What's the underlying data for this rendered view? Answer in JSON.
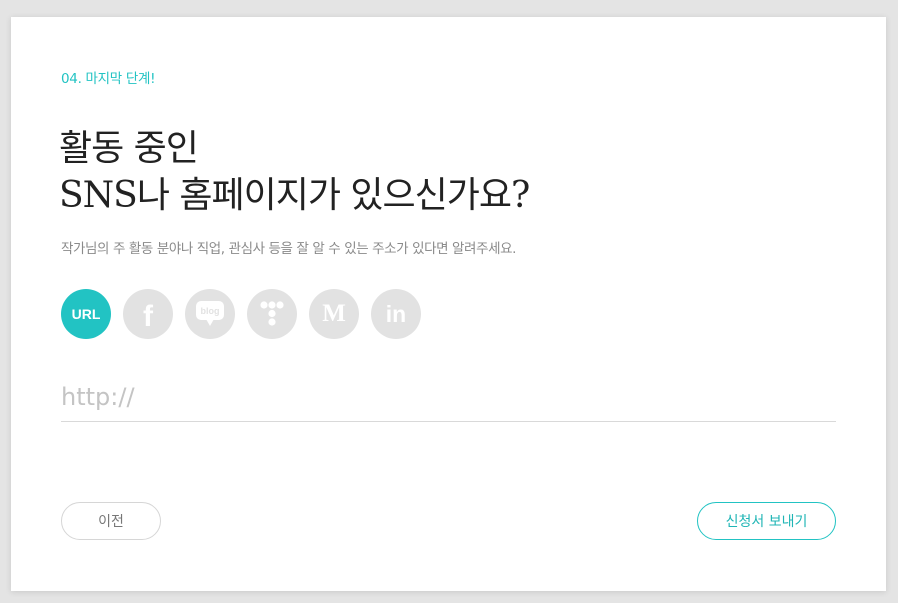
{
  "step_label": "04. 마지막 단계!",
  "title_lines": [
    "활동 중인",
    "SNS나 홈페이지가 있으신가요?"
  ],
  "subtitle": "작가님의 주 활동 분야나 직업, 관심사 등을 잘 알 수 있는 주소가 있다면 알려주세요.",
  "sns_options": [
    {
      "icon": "url-icon",
      "label": "URL",
      "selected": true
    },
    {
      "icon": "facebook-icon",
      "label": "f",
      "selected": false
    },
    {
      "icon": "blog-icon",
      "label": "blog",
      "selected": false
    },
    {
      "icon": "tumblbug-icon",
      "label": "",
      "selected": false
    },
    {
      "icon": "medium-icon",
      "label": "M",
      "selected": false
    },
    {
      "icon": "linkedin-icon",
      "label": "in",
      "selected": false
    }
  ],
  "url_field": {
    "placeholder": "http://",
    "value": ""
  },
  "buttons": {
    "prev": "이전",
    "submit": "신청서 보내기"
  },
  "colors": {
    "accent": "#22c3c3",
    "icon_inactive": "#e2e2e2",
    "background": "#e4e4e4"
  }
}
